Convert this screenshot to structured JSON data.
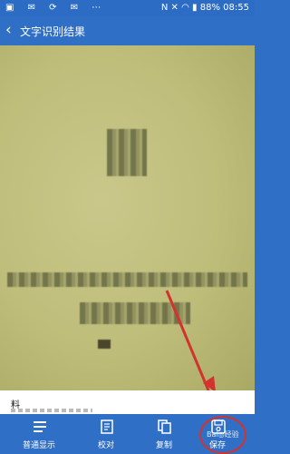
{
  "status_bar": {
    "left_icons": [
      "image-icon",
      "envelope-icon",
      "sync-icon",
      "mail-icon",
      "dots-icon"
    ],
    "battery": "88%",
    "time": "08:55"
  },
  "app_bar": {
    "title": "文字识别结果"
  },
  "result": {
    "first_line": "料"
  },
  "toolbar": [
    {
      "label": "普通显示",
      "icon": "list-icon"
    },
    {
      "label": "校对",
      "icon": "proofread-icon"
    },
    {
      "label": "复制",
      "icon": "copy-icon"
    },
    {
      "label": "保存",
      "icon": "save-icon"
    }
  ],
  "annotation_color": "#d2332e"
}
